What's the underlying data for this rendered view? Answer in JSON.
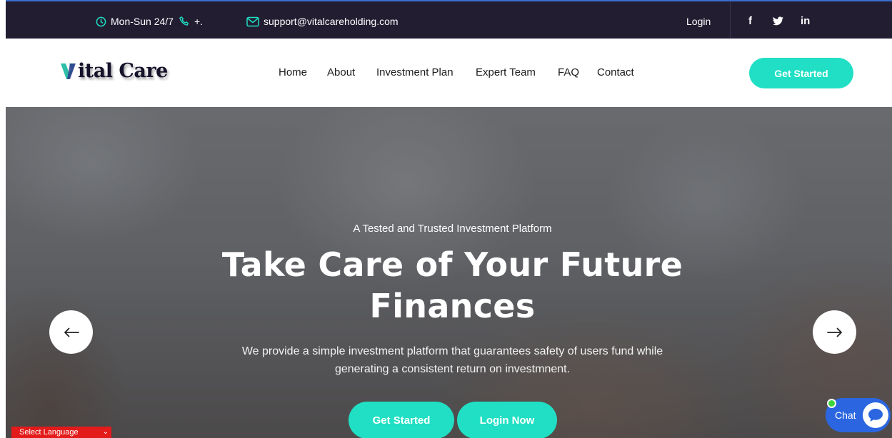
{
  "topbar": {
    "hours": "Mon-Sun 24/7",
    "phone": "+.",
    "email": "support@vitalcareholding.com",
    "login": "Login",
    "social": {
      "facebook": "f",
      "linkedin": "in"
    }
  },
  "nav": {
    "logo_text": "ital Care",
    "items": [
      "Home",
      "About",
      "Investment Plan",
      "Expert Team",
      "FAQ",
      "Contact"
    ],
    "cta": "Get Started"
  },
  "hero": {
    "kicker": "A Tested and Trusted Investment Platform",
    "title_line1": "Take Care of Your Future",
    "title_line2": "Finances",
    "desc_line1": "We provide a simple investment platform that guarantees safety of users fund while",
    "desc_line2": "generating a consistent return on investmnent.",
    "btn_start": "Get Started",
    "btn_login": "Login Now"
  },
  "chat": {
    "label": "Chat"
  },
  "language": {
    "label": "Select Language"
  },
  "colors": {
    "accent": "#20dfc4",
    "topbar": "#221d31",
    "chat": "#2b66e0",
    "lang": "#e31b1b"
  }
}
